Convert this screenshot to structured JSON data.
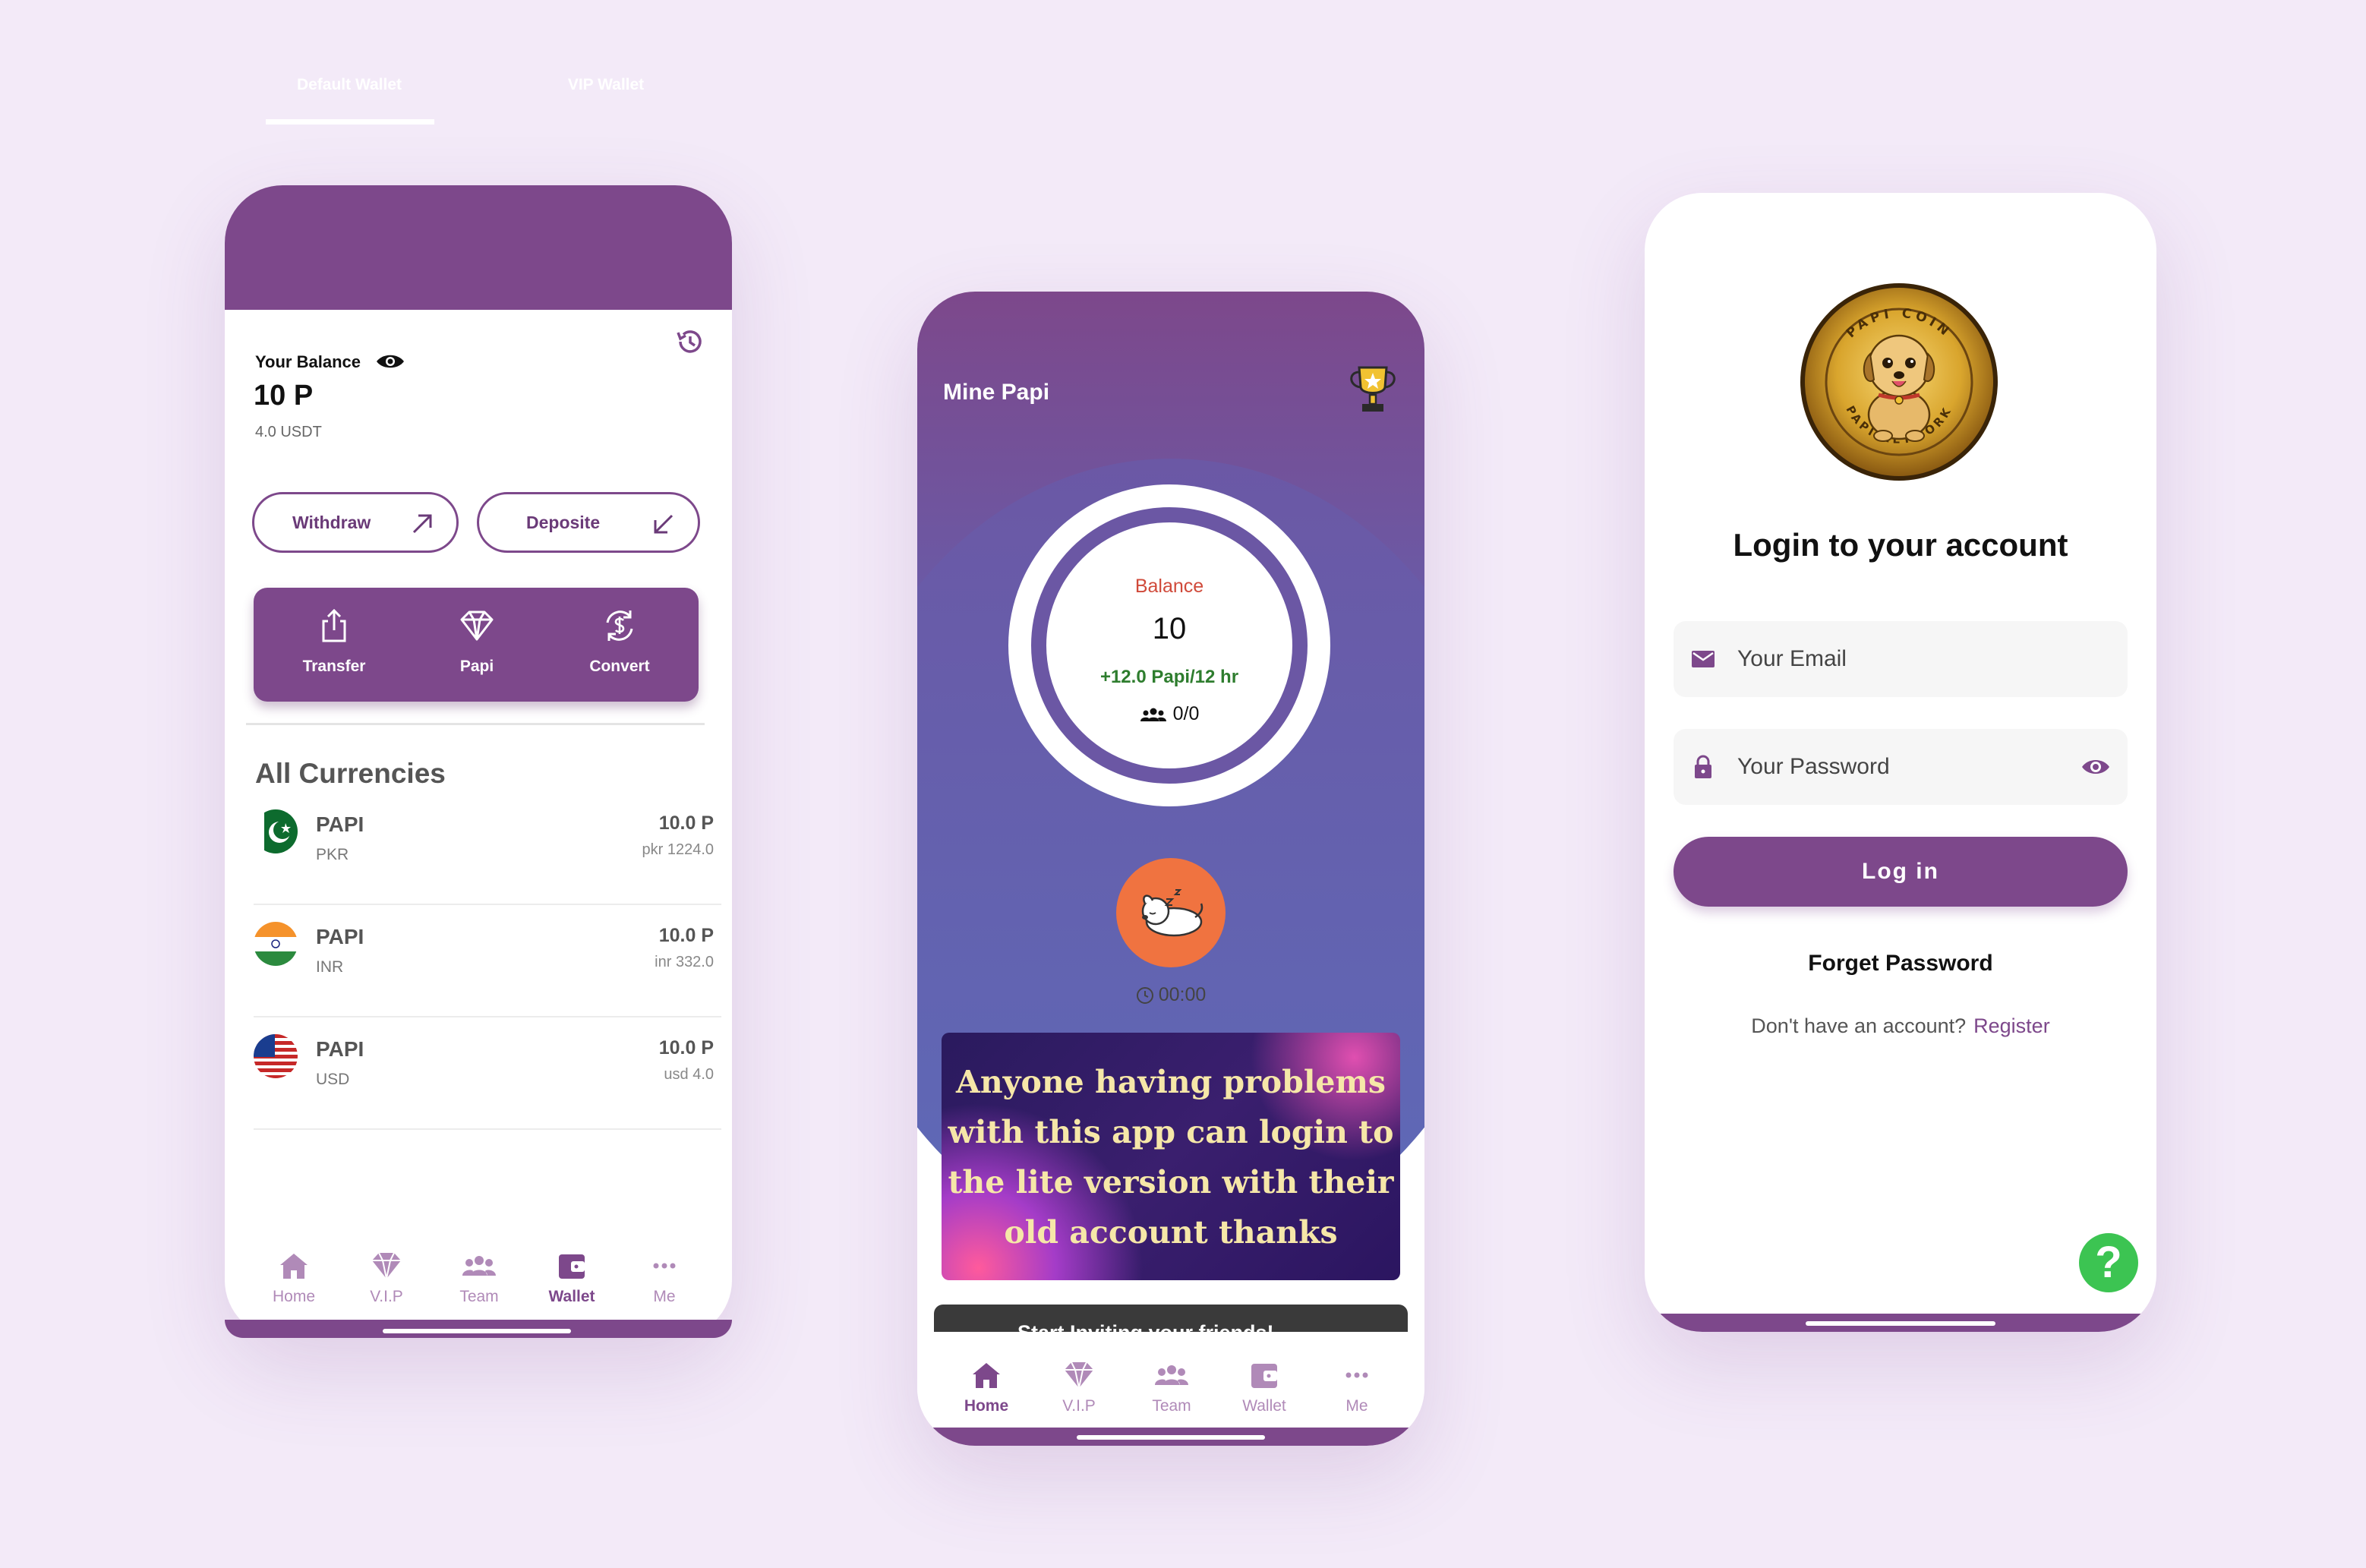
{
  "colors": {
    "background": "#f3eaf8",
    "brand": "#7d488b",
    "accent_orange": "#f07340",
    "help_green": "#3cc452"
  },
  "wallet": {
    "tabs": [
      {
        "label": "Default Wallet",
        "active": true
      },
      {
        "label": "VIP Wallet",
        "active": false
      }
    ],
    "balance_label": "Your Balance",
    "balance_value": "10 P",
    "balance_usdt": "4.0 USDT",
    "withdraw_label": "Withdraw",
    "deposit_label": "Deposite",
    "actions": [
      {
        "label": "Transfer",
        "icon": "share-icon"
      },
      {
        "label": "Papi",
        "icon": "diamond-icon"
      },
      {
        "label": "Convert",
        "icon": "convert-icon"
      }
    ],
    "all_currencies_title": "All Currencies",
    "currencies": [
      {
        "name": "PAPI",
        "code": "PKR",
        "amount": "10.0 P",
        "converted": "pkr 1224.0",
        "flag": "pakistan-flag-icon"
      },
      {
        "name": "PAPI",
        "code": "INR",
        "amount": "10.0 P",
        "converted": "inr 332.0",
        "flag": "india-flag-icon"
      },
      {
        "name": "PAPI",
        "code": "USD",
        "amount": "10.0 P",
        "converted": "usd 4.0",
        "flag": "usa-flag-icon"
      }
    ],
    "nav": [
      {
        "label": "Home"
      },
      {
        "label": "V.I.P"
      },
      {
        "label": "Team"
      },
      {
        "label": "Wallet",
        "active": true
      },
      {
        "label": "Me"
      }
    ]
  },
  "mine": {
    "title": "Mine Papi",
    "balance_label": "Balance",
    "balance_value": "10",
    "rate": "+12.0 Papi/12 hr",
    "team_count": "0/0",
    "timer": "00:00",
    "banner_text": "Anyone having problems with this app can login to the lite version with their old account thanks",
    "invite_text": "Start Inviting your friends!",
    "nav": [
      {
        "label": "Home",
        "active": true
      },
      {
        "label": "V.I.P"
      },
      {
        "label": "Team"
      },
      {
        "label": "Wallet"
      },
      {
        "label": "Me"
      }
    ]
  },
  "login": {
    "logo_text_top": "PAPI COIN",
    "logo_text_bottom": "PAPI NETWORK",
    "title": "Login to your account",
    "email_placeholder": "Your Email",
    "password_placeholder": "Your Password",
    "login_button": "Log in",
    "forget_password": "Forget Password",
    "no_account_text": "Don't have an account?",
    "register_link": "Register",
    "help_symbol": "?"
  }
}
